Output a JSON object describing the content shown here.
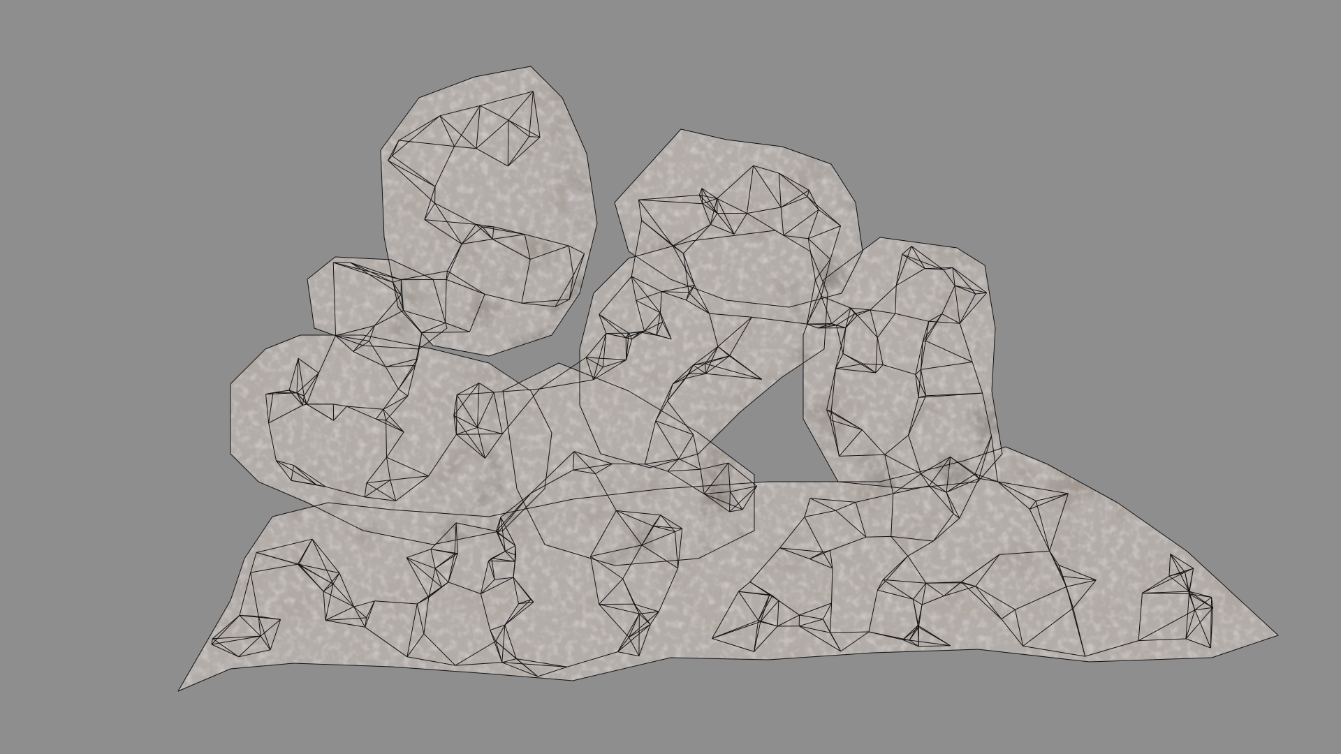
{
  "scene": {
    "subject": "rock-pile-model",
    "colors": {
      "background": "#8e8e8e",
      "rock_light": "#b9aea6",
      "rock_mid": "#9c918a",
      "rock_dark": "#6f6862",
      "wire": "#111111"
    }
  }
}
